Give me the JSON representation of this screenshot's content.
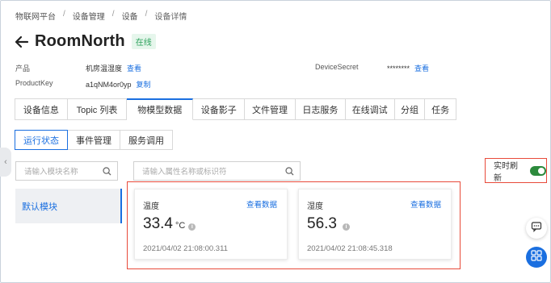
{
  "breadcrumb": [
    "物联网平台",
    "设备管理",
    "设备",
    "设备详情"
  ],
  "device": {
    "name": "RoomNorth",
    "status": "在线"
  },
  "meta": {
    "product_label": "产品",
    "product_value": "机房温湿度",
    "product_link": "查看",
    "productkey_label": "ProductKey",
    "productkey_value": "a1qNM4or0yp",
    "productkey_link": "复制",
    "secret_label": "DeviceSecret",
    "secret_value": "********",
    "secret_link": "查看"
  },
  "tabs": [
    "设备信息",
    "Topic 列表",
    "物模型数据",
    "设备影子",
    "文件管理",
    "日志服务",
    "在线调试",
    "分组",
    "任务"
  ],
  "active_tab": "物模型数据",
  "subtabs": [
    "运行状态",
    "事件管理",
    "服务调用"
  ],
  "module_search_placeholder": "请输入模块名称",
  "attr_search_placeholder": "请输入属性名称或标识符",
  "realtime_refresh": {
    "label": "实时刷新",
    "on": true
  },
  "modules": [
    "默认模块"
  ],
  "cards": [
    {
      "label": "温度",
      "link": "查看数据",
      "value": "33.4",
      "unit": "°C",
      "time": "2021/04/02 21:08:00.311"
    },
    {
      "label": "湿度",
      "link": "查看数据",
      "value": "56.3",
      "unit": "",
      "time": "2021/04/02 21:08:45.318"
    }
  ],
  "colors": {
    "accent": "#1a6fe0",
    "online": "#2aa15a",
    "highlight": "#e84a3a",
    "toggle_on": "#2c8a3c"
  }
}
